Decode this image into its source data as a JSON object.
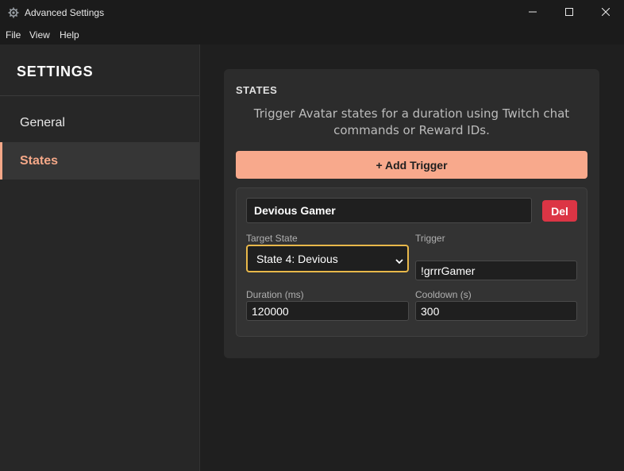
{
  "window": {
    "title": "Advanced Settings",
    "app_icon": "gear-icon",
    "controls": [
      "minimize-icon",
      "maximize-icon",
      "close-icon"
    ]
  },
  "menu": {
    "items": [
      "File",
      "View",
      "Help"
    ]
  },
  "sidebar": {
    "heading": "SETTINGS",
    "items": [
      {
        "label": "General",
        "active": false
      },
      {
        "label": "States",
        "active": true
      }
    ]
  },
  "states_card": {
    "title": "STATES",
    "description": "Trigger Avatar states for a duration using Twitch chat commands or Reward IDs.",
    "add_button": "+ Add Trigger",
    "triggers": [
      {
        "name": "Devious Gamer",
        "delete_label": "Del",
        "target_state_label": "Target State",
        "target_state_value": "State 4: Devious",
        "trigger_label": "Trigger",
        "trigger_value": "!grrrGamer",
        "duration_label": "Duration (ms)",
        "duration_value": "120000",
        "cooldown_label": "Cooldown (s)",
        "cooldown_value": "300"
      }
    ]
  },
  "colors": {
    "accent": "#f8a98c",
    "danger": "#dc3545",
    "focus": "#e8b84a",
    "background": "#1f1f1f",
    "sidebar": "#272727",
    "card": "#2c2c2c"
  }
}
